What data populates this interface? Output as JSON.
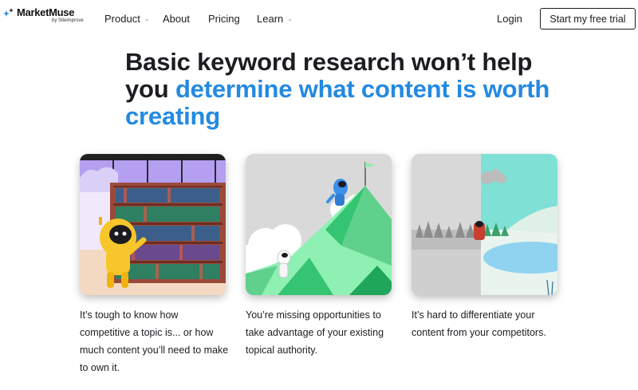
{
  "nav": {
    "logo_name": "MarketMuse",
    "logo_sub": "by Siteimprove",
    "items": [
      {
        "label": "Product",
        "has_dropdown": true
      },
      {
        "label": "About",
        "has_dropdown": false
      },
      {
        "label": "Pricing",
        "has_dropdown": false
      },
      {
        "label": "Learn",
        "has_dropdown": true
      }
    ],
    "login_label": "Login",
    "cta_label": "Start my free trial"
  },
  "hero": {
    "headline_part1": "Basic keyword research won’t help you ",
    "headline_part2": "determine what content is worth creating"
  },
  "cards": [
    {
      "illustration": "library-bookshelf-robot",
      "caption": "It’s tough to know how competitive a topic is... or how much content you’ll need to make to own it."
    },
    {
      "illustration": "mountain-climb-flag",
      "caption": "You’re missing opportunities to take advantage of your existing topical authority."
    },
    {
      "illustration": "winter-lake-split-color",
      "caption": "It’s hard to differentiate your content from your competitors."
    }
  ],
  "colors": {
    "accent_blue": "#2389e2",
    "text_dark": "#1b1d21"
  }
}
